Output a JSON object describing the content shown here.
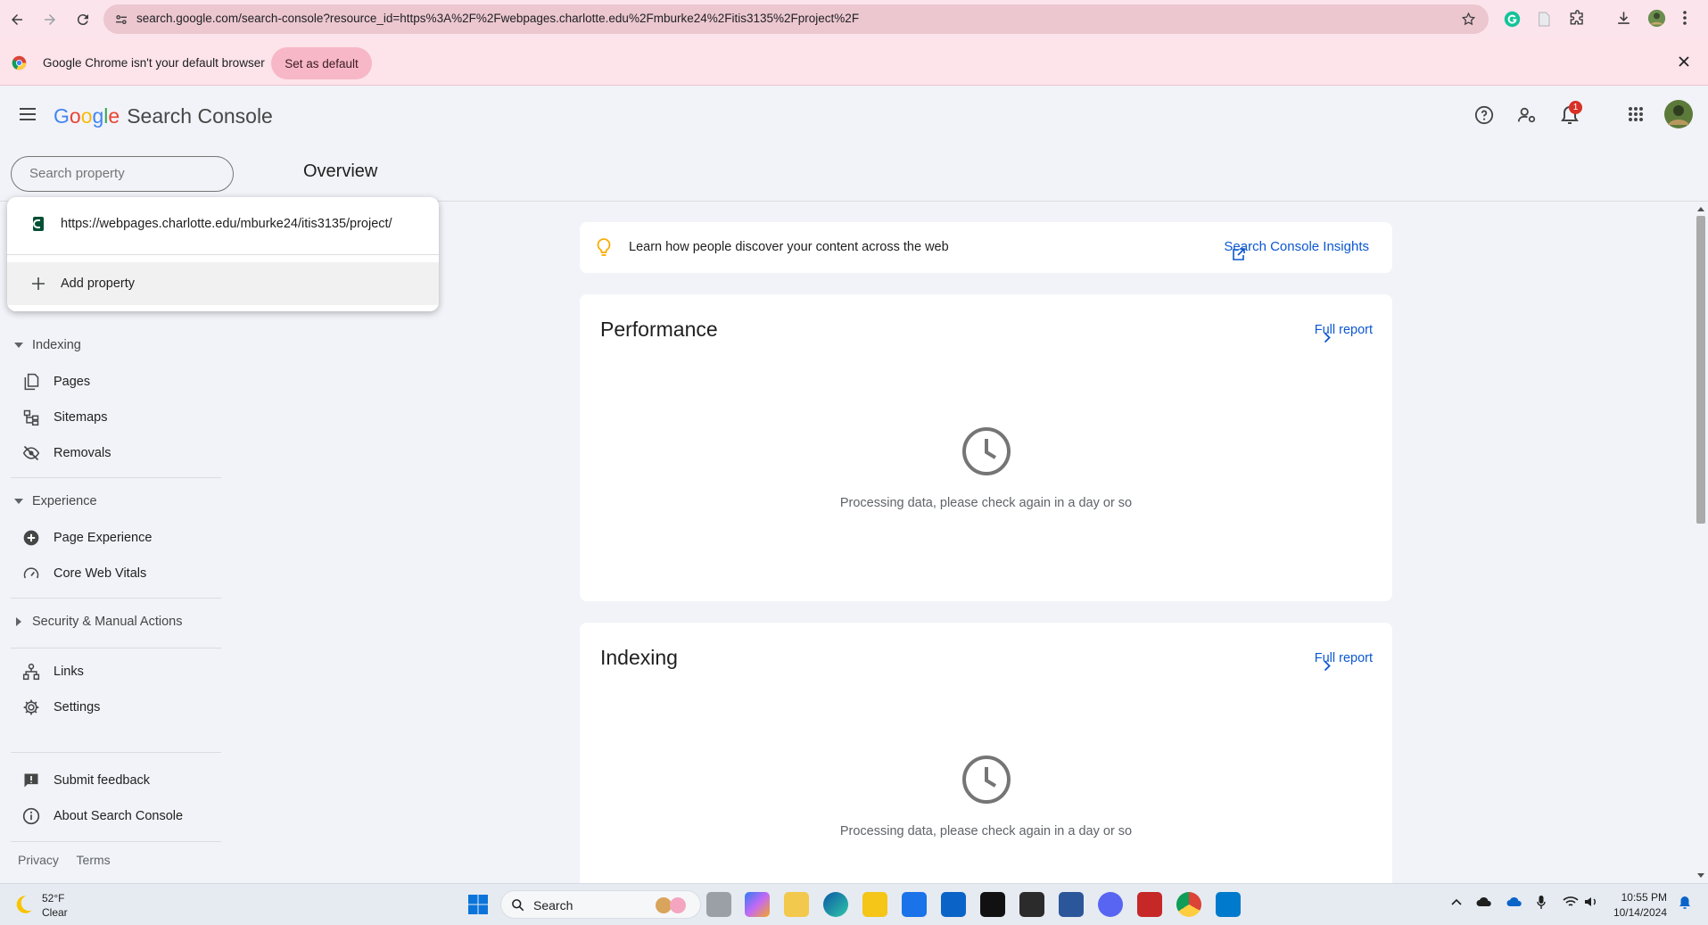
{
  "browser": {
    "url": "search.google.com/search-console?resource_id=https%3A%2F%2Fwebpages.charlotte.edu%2Fmburke24%2Fitis3135%2Fproject%2F",
    "infobar_text": "Google Chrome isn't your default browser",
    "set_default_label": "Set as default"
  },
  "header": {
    "brand_letters": [
      "G",
      "o",
      "o",
      "g",
      "l",
      "e"
    ],
    "product_name": "Search Console",
    "notification_count": "1"
  },
  "search": {
    "placeholder": "Search property"
  },
  "page_title": "Overview",
  "dropdown": {
    "property_url": "https://webpages.charlotte.edu/mburke24/itis3135/project/",
    "add_property_label": "Add property"
  },
  "sidebar": {
    "indexing_header": "Indexing",
    "indexing_items": [
      {
        "label": "Pages",
        "icon": "pages-icon"
      },
      {
        "label": "Sitemaps",
        "icon": "sitemaps-icon"
      },
      {
        "label": "Removals",
        "icon": "removals-icon"
      }
    ],
    "experience_header": "Experience",
    "experience_items": [
      {
        "label": "Page Experience",
        "icon": "page-experience-icon"
      },
      {
        "label": "Core Web Vitals",
        "icon": "gauge-icon"
      }
    ],
    "security_header": "Security & Manual Actions",
    "other_items": [
      {
        "label": "Links",
        "icon": "links-icon"
      },
      {
        "label": "Settings",
        "icon": "settings-icon"
      }
    ],
    "bottom_items": [
      {
        "label": "Submit feedback",
        "icon": "feedback-icon"
      },
      {
        "label": "About Search Console",
        "icon": "info-icon"
      }
    ],
    "footer": {
      "privacy": "Privacy",
      "terms": "Terms"
    }
  },
  "main": {
    "insight_text": "Learn how people discover your content across the web",
    "insight_link": "Search Console Insights",
    "cards": [
      {
        "title": "Performance",
        "link": "Full report",
        "message": "Processing data, please check again in a day or so"
      },
      {
        "title": "Indexing",
        "link": "Full report",
        "message": "Processing data, please check again in a day or so"
      }
    ]
  },
  "taskbar": {
    "weather_temp": "52°F",
    "weather_condition": "Clear",
    "search_label": "Search",
    "time": "10:55 PM",
    "date": "10/14/2024"
  },
  "colors": {
    "accent": "#0b57d0",
    "chrome_bar": "#fce4ec",
    "badge": "#d93025"
  }
}
